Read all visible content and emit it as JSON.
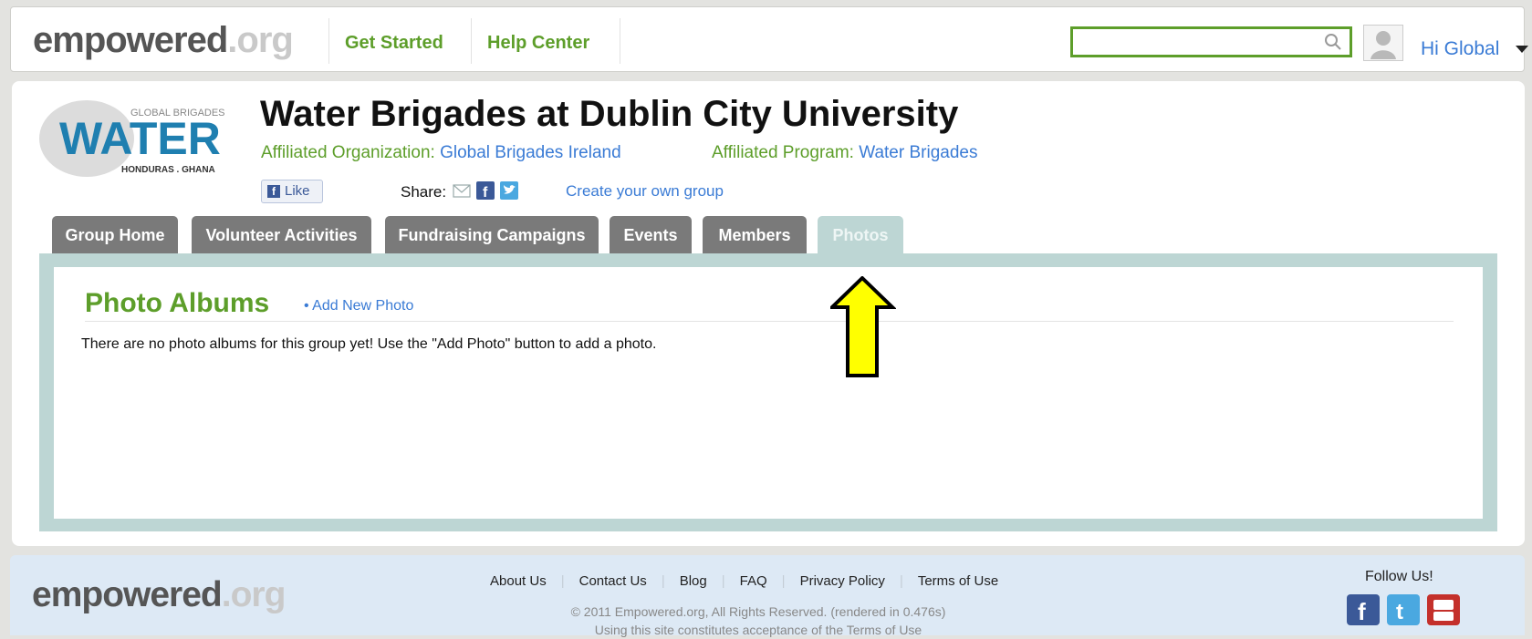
{
  "header": {
    "logo_main": "empowered",
    "logo_tld": ".org",
    "nav": [
      "Get Started",
      "Help Center"
    ],
    "search_placeholder": "",
    "greeting": "Hi Global"
  },
  "group": {
    "logo_text_top": "GLOBAL BRIGADES",
    "logo_text_main": "WATER",
    "logo_text_sub": "HONDURAS . GHANA",
    "title": "Water Brigades at Dublin City University",
    "affiliated_org_label": "Affiliated Organization:",
    "affiliated_org": "Global Brigades Ireland",
    "affiliated_program_label": "Affiliated Program:",
    "affiliated_program": "Water Brigades",
    "like_label": "Like",
    "share_label": "Share:",
    "create_group": "Create your own group"
  },
  "tabs": [
    "Group Home",
    "Volunteer Activities",
    "Fundraising Campaigns",
    "Events",
    "Members",
    "Photos"
  ],
  "active_tab": "Photos",
  "photos": {
    "title": "Photo Albums",
    "add_link": "• Add New Photo",
    "empty_message": "There are no photo albums for this group yet!  Use the \"Add Photo\" button to add a photo."
  },
  "footer": {
    "logo_main": "empowered",
    "logo_tld": ".org",
    "links": [
      "About Us",
      "Contact Us",
      "Blog",
      "FAQ",
      "Privacy Policy",
      "Terms of Use"
    ],
    "copyright": "© 2011 Empowered.org, All Rights Reserved. (rendered in 0.476s)",
    "terms_note": "Using this site constitutes acceptance of the Terms of Use",
    "follow": "Follow Us!"
  },
  "colors": {
    "accent_green": "#5d9e2a",
    "link_blue": "#3a7bd5",
    "tab_gray": "#7a7a7a",
    "tab_active": "#bdd6d4",
    "arrow_yellow": "#ffff00"
  },
  "icons": [
    "search-icon",
    "avatar-icon",
    "caret-down-icon",
    "facebook-icon",
    "email-icon",
    "twitter-icon",
    "youtube-icon",
    "arrow-up-icon"
  ]
}
